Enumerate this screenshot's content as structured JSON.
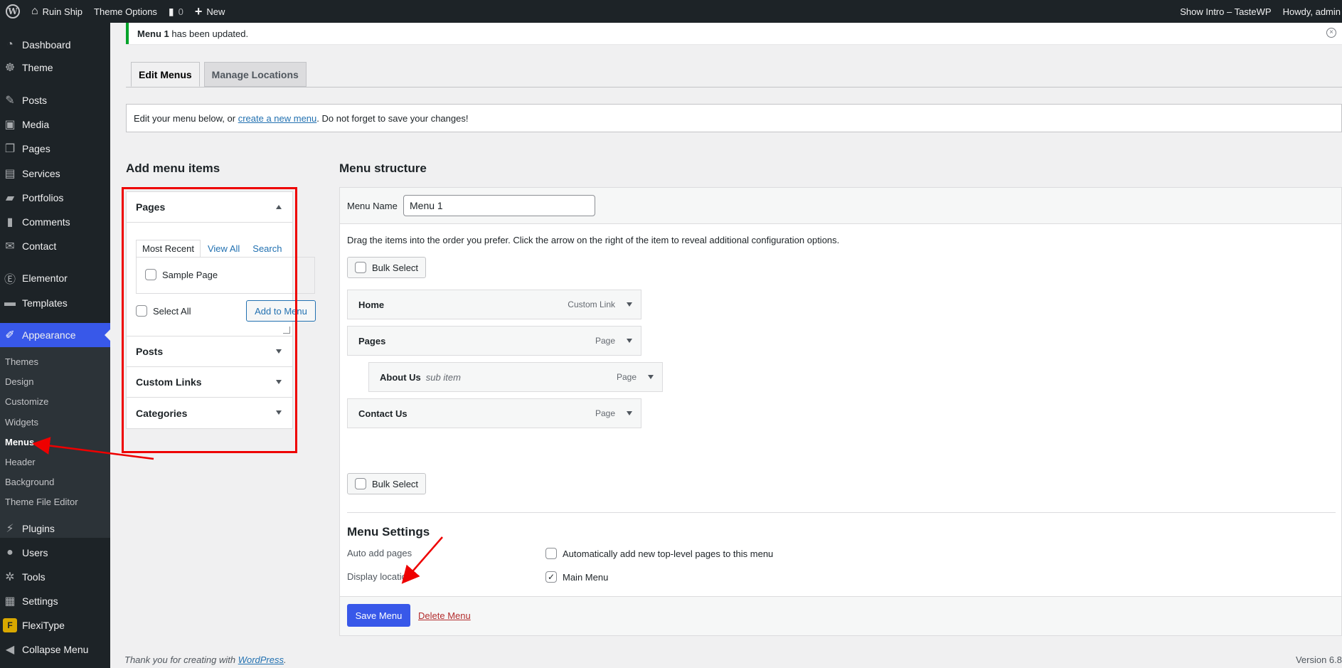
{
  "adminbar": {
    "site_name": "Ruin Ship",
    "theme_options": "Theme Options",
    "comments_count": "0",
    "new_label": "New",
    "show_intro": "Show Intro – TasteWP",
    "howdy": "Howdy, admin"
  },
  "sidebar": {
    "dashboard": "Dashboard",
    "theme": "Theme",
    "posts": "Posts",
    "media": "Media",
    "pages": "Pages",
    "services": "Services",
    "portfolios": "Portfolios",
    "comments": "Comments",
    "contact": "Contact",
    "elementor": "Elementor",
    "templates": "Templates",
    "appearance": "Appearance",
    "sub": {
      "themes": "Themes",
      "design": "Design",
      "customize": "Customize",
      "widgets": "Widgets",
      "menus": "Menus",
      "header": "Header",
      "background": "Background",
      "theme_file_editor": "Theme File Editor"
    },
    "plugins": "Plugins",
    "users": "Users",
    "tools": "Tools",
    "settings": "Settings",
    "flexitype": "FlexiType",
    "collapse": "Collapse Menu"
  },
  "notice": {
    "bold": "Menu 1",
    "text": " has been updated."
  },
  "tabs": {
    "edit": "Edit Menus",
    "manage": "Manage Locations"
  },
  "manage_bar": {
    "before": "Edit your menu below, or ",
    "link": "create a new menu",
    "after": ". Do not forget to save your changes!"
  },
  "add_items": {
    "title": "Add menu items",
    "pages_title": "Pages",
    "tab_recent": "Most Recent",
    "tab_view_all": "View All",
    "tab_search": "Search",
    "sample_page": "Sample Page",
    "select_all": "Select All",
    "add_button": "Add to Menu",
    "posts": "Posts",
    "custom_links": "Custom Links",
    "categories": "Categories"
  },
  "structure": {
    "title": "Menu structure",
    "name_label": "Menu Name",
    "name_value": "Menu 1",
    "instructions": "Drag the items into the order you prefer. Click the arrow on the right of the item to reveal additional configuration options.",
    "bulk_select": "Bulk Select",
    "items": [
      {
        "title": "Home",
        "sub": "",
        "type": "Custom Link"
      },
      {
        "title": "Pages",
        "sub": "",
        "type": "Page"
      },
      {
        "title": "About Us",
        "sub": "sub item",
        "type": "Page"
      },
      {
        "title": "Contact Us",
        "sub": "",
        "type": "Page"
      }
    ]
  },
  "settings": {
    "title": "Menu Settings",
    "auto_add_label": "Auto add pages",
    "auto_add_text": "Automatically add new top-level pages to this menu",
    "display_label": "Display location",
    "main_menu": "Main Menu",
    "check": "✓"
  },
  "actions": {
    "save": "Save Menu",
    "delete": "Delete Menu"
  },
  "footer": {
    "thanks": "Thank you for creating with ",
    "wp": "WordPress",
    "period": ".",
    "version": "Version 6.8"
  },
  "colors": {
    "accent": "#3858e9",
    "annotation_red": "#e00000",
    "sidebar_bg": "#1d2327",
    "notice_green": "#00a32a"
  }
}
